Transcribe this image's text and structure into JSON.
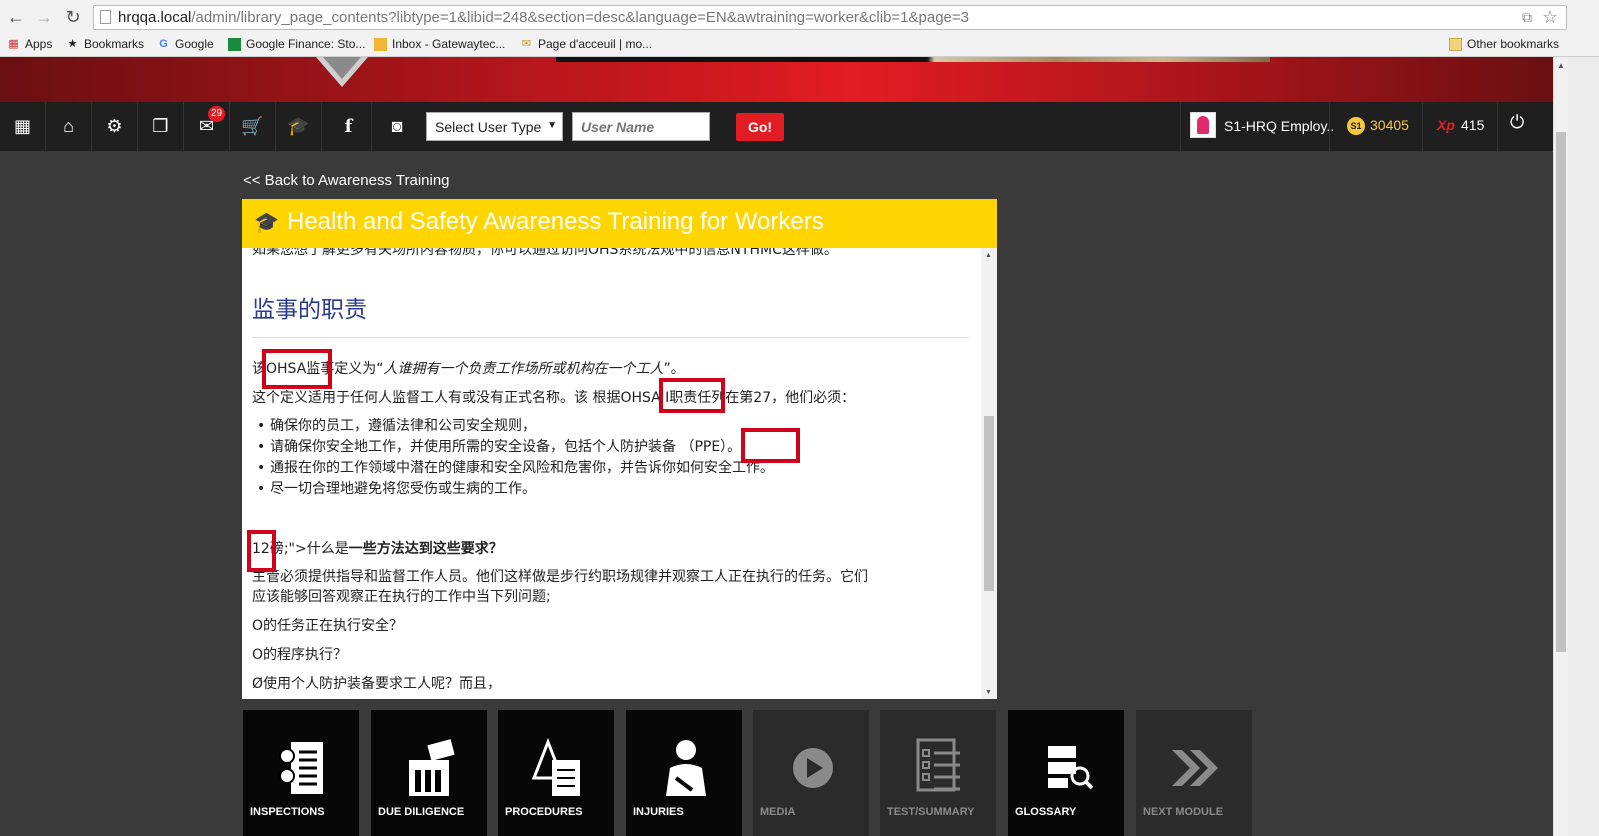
{
  "browser": {
    "url_host": "hrqqa.local",
    "url_path": "/admin/library_page_contents?libtype=1&libid=248&section=desc&language=EN&awtraining=worker&clib=1&page=3",
    "bookmarks": [
      "Apps",
      "Bookmarks",
      "Google",
      "Google Finance: Sto...",
      "Inbox - Gatewaytec...",
      "Page d'acceuil | mo..."
    ],
    "other_bookmarks": "Other bookmarks"
  },
  "navbar": {
    "messages_badge": "29",
    "select_user_type": "Select User Type",
    "username_placeholder": "User Name",
    "go_label": "Go!",
    "user_label": "S1-HRQ Employ..",
    "coin_symbol": "S1",
    "coins": "30405",
    "xp_symbol": "Xp",
    "xp": "415"
  },
  "back_link": "<< Back to Awareness Training",
  "panel": {
    "title": "Health and Safety Awareness Training for Workers",
    "cut_line": "如果您想了解更多有关场所内容物质，你可以通过访问OHS系统法规中的信息NTHMC这样做。",
    "section_title": "监事的职责",
    "p1_pre": "该",
    "p1_mid": "OHSA监事定义为“",
    "p1_em": "人谁拥有一个负责工作场所或机构在一个工人",
    "p1_post": "”。",
    "p2": "这个定义适用于任何人监督工人有或没有正式名称。该 根据OHSA I职责任列在第27，他们必须：",
    "bullets": [
      "确保你的员工，遵循法律和公司安全规则，",
      "请确保你安全地工作，并使用所需的安全设备，包括个人防护装备 （PPE）。",
      "通报在你的工作领域中潜在的健康和安全风险和危害你，并告诉你如何安全工作。",
      "尽一切合理地避免将您受伤或生病的工作。"
    ],
    "q_prefix": "12磅;\">什么是",
    "q_bold": "一些方法达到这些要求？",
    "p3a": "主管必须提供指导和监督工作人员。他们这样做是步行约职场规律并观察工人正在执行的任务。它们",
    "p3b": "应该能够回答观察正在执行的工作中当下列问题;",
    "p4": "O的任务正在执行安全？",
    "p5": "O的程序执行？",
    "p6": "Ø使用个人防护装备要求工人呢？而且，"
  },
  "tiles": [
    {
      "label": "INSPECTIONS",
      "icon": "inspection-checklist-icon",
      "dim": false
    },
    {
      "label": "DUE DILIGENCE",
      "icon": "due-diligence-icon",
      "dim": false
    },
    {
      "label": "PROCEDURES",
      "icon": "procedures-icon",
      "dim": false
    },
    {
      "label": "INJURIES",
      "icon": "injured-person-icon",
      "dim": false
    },
    {
      "label": "MEDIA",
      "icon": "play-icon",
      "dim": true
    },
    {
      "label": "TEST/SUMMARY",
      "icon": "test-checklist-icon",
      "dim": true
    },
    {
      "label": "GLOSSARY",
      "icon": "glossary-icon",
      "dim": false
    },
    {
      "label": "NEXT MODULE",
      "icon": "next-chevrons-icon",
      "dim": true
    }
  ]
}
